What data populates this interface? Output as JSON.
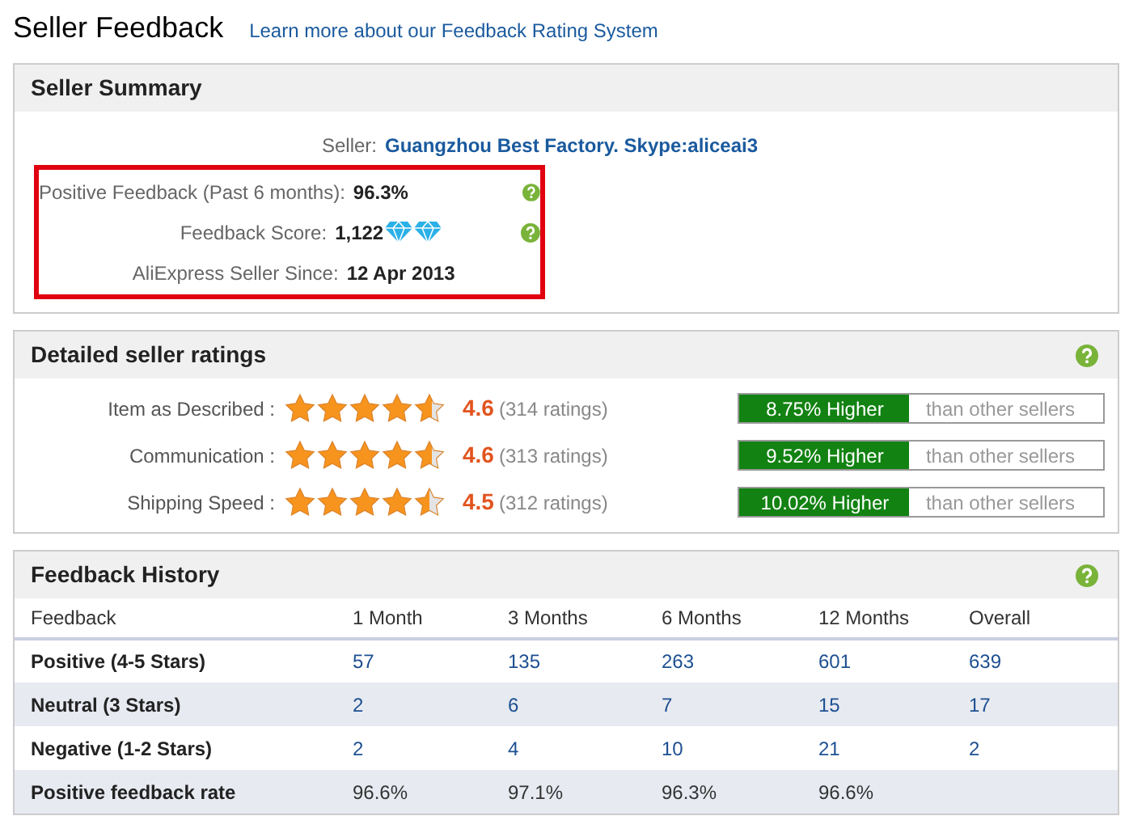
{
  "page": {
    "title": "Seller Feedback",
    "link": "Learn more about our Feedback Rating System"
  },
  "summary": {
    "title": "Seller Summary",
    "rows": [
      {
        "label": "Seller:",
        "value": "Guangzhou Best Factory. Skype:aliceai3",
        "kind": "link",
        "highlighted": false
      },
      {
        "label": "Positive Feedback (Past 6 months):",
        "value": "96.3%",
        "kind": "help",
        "highlighted": true
      },
      {
        "label": "Feedback Score:",
        "value": "1,122",
        "kind": "two_diamond_score",
        "highlighted": true
      },
      {
        "label": "AliExpress Seller Since:",
        "value": "12 Apr 2013",
        "kind": "plain",
        "highlighted": true
      }
    ]
  },
  "ratings": {
    "title": "Detailed seller ratings",
    "rows": [
      {
        "label": "Item as Described :",
        "stars": 4.6,
        "score": "4.6",
        "count": "(314 ratings)",
        "compare": "8.75% Higher",
        "compare_note": "than other sellers"
      },
      {
        "label": "Communication :",
        "stars": 4.6,
        "score": "4.6",
        "count": "(313 ratings)",
        "compare": "9.52% Higher",
        "compare_note": "than other sellers"
      },
      {
        "label": "Shipping Speed :",
        "stars": 4.5,
        "score": "4.5",
        "count": "(312 ratings)",
        "compare": "10.02% Higher",
        "compare_note": "than other sellers"
      }
    ]
  },
  "history": {
    "title": "Feedback History",
    "columns": [
      "Feedback",
      "1 Month",
      "3 Months",
      "6 Months",
      "12 Months",
      "Overall"
    ],
    "rows": [
      {
        "cells": [
          "Positive (4-5 Stars)",
          "57",
          "135",
          "263",
          "601",
          "639"
        ],
        "kind": "count"
      },
      {
        "cells": [
          "Neutral (3 Stars)",
          "2",
          "6",
          "7",
          "15",
          "17"
        ],
        "kind": "count"
      },
      {
        "cells": [
          "Negative (1-2 Stars)",
          "2",
          "4",
          "10",
          "21",
          "2"
        ],
        "kind": "count"
      },
      {
        "cells": [
          "Positive feedback rate",
          "96.6%",
          "97.1%",
          "96.3%",
          "96.6%"
        ],
        "kind": "rate"
      }
    ]
  }
}
